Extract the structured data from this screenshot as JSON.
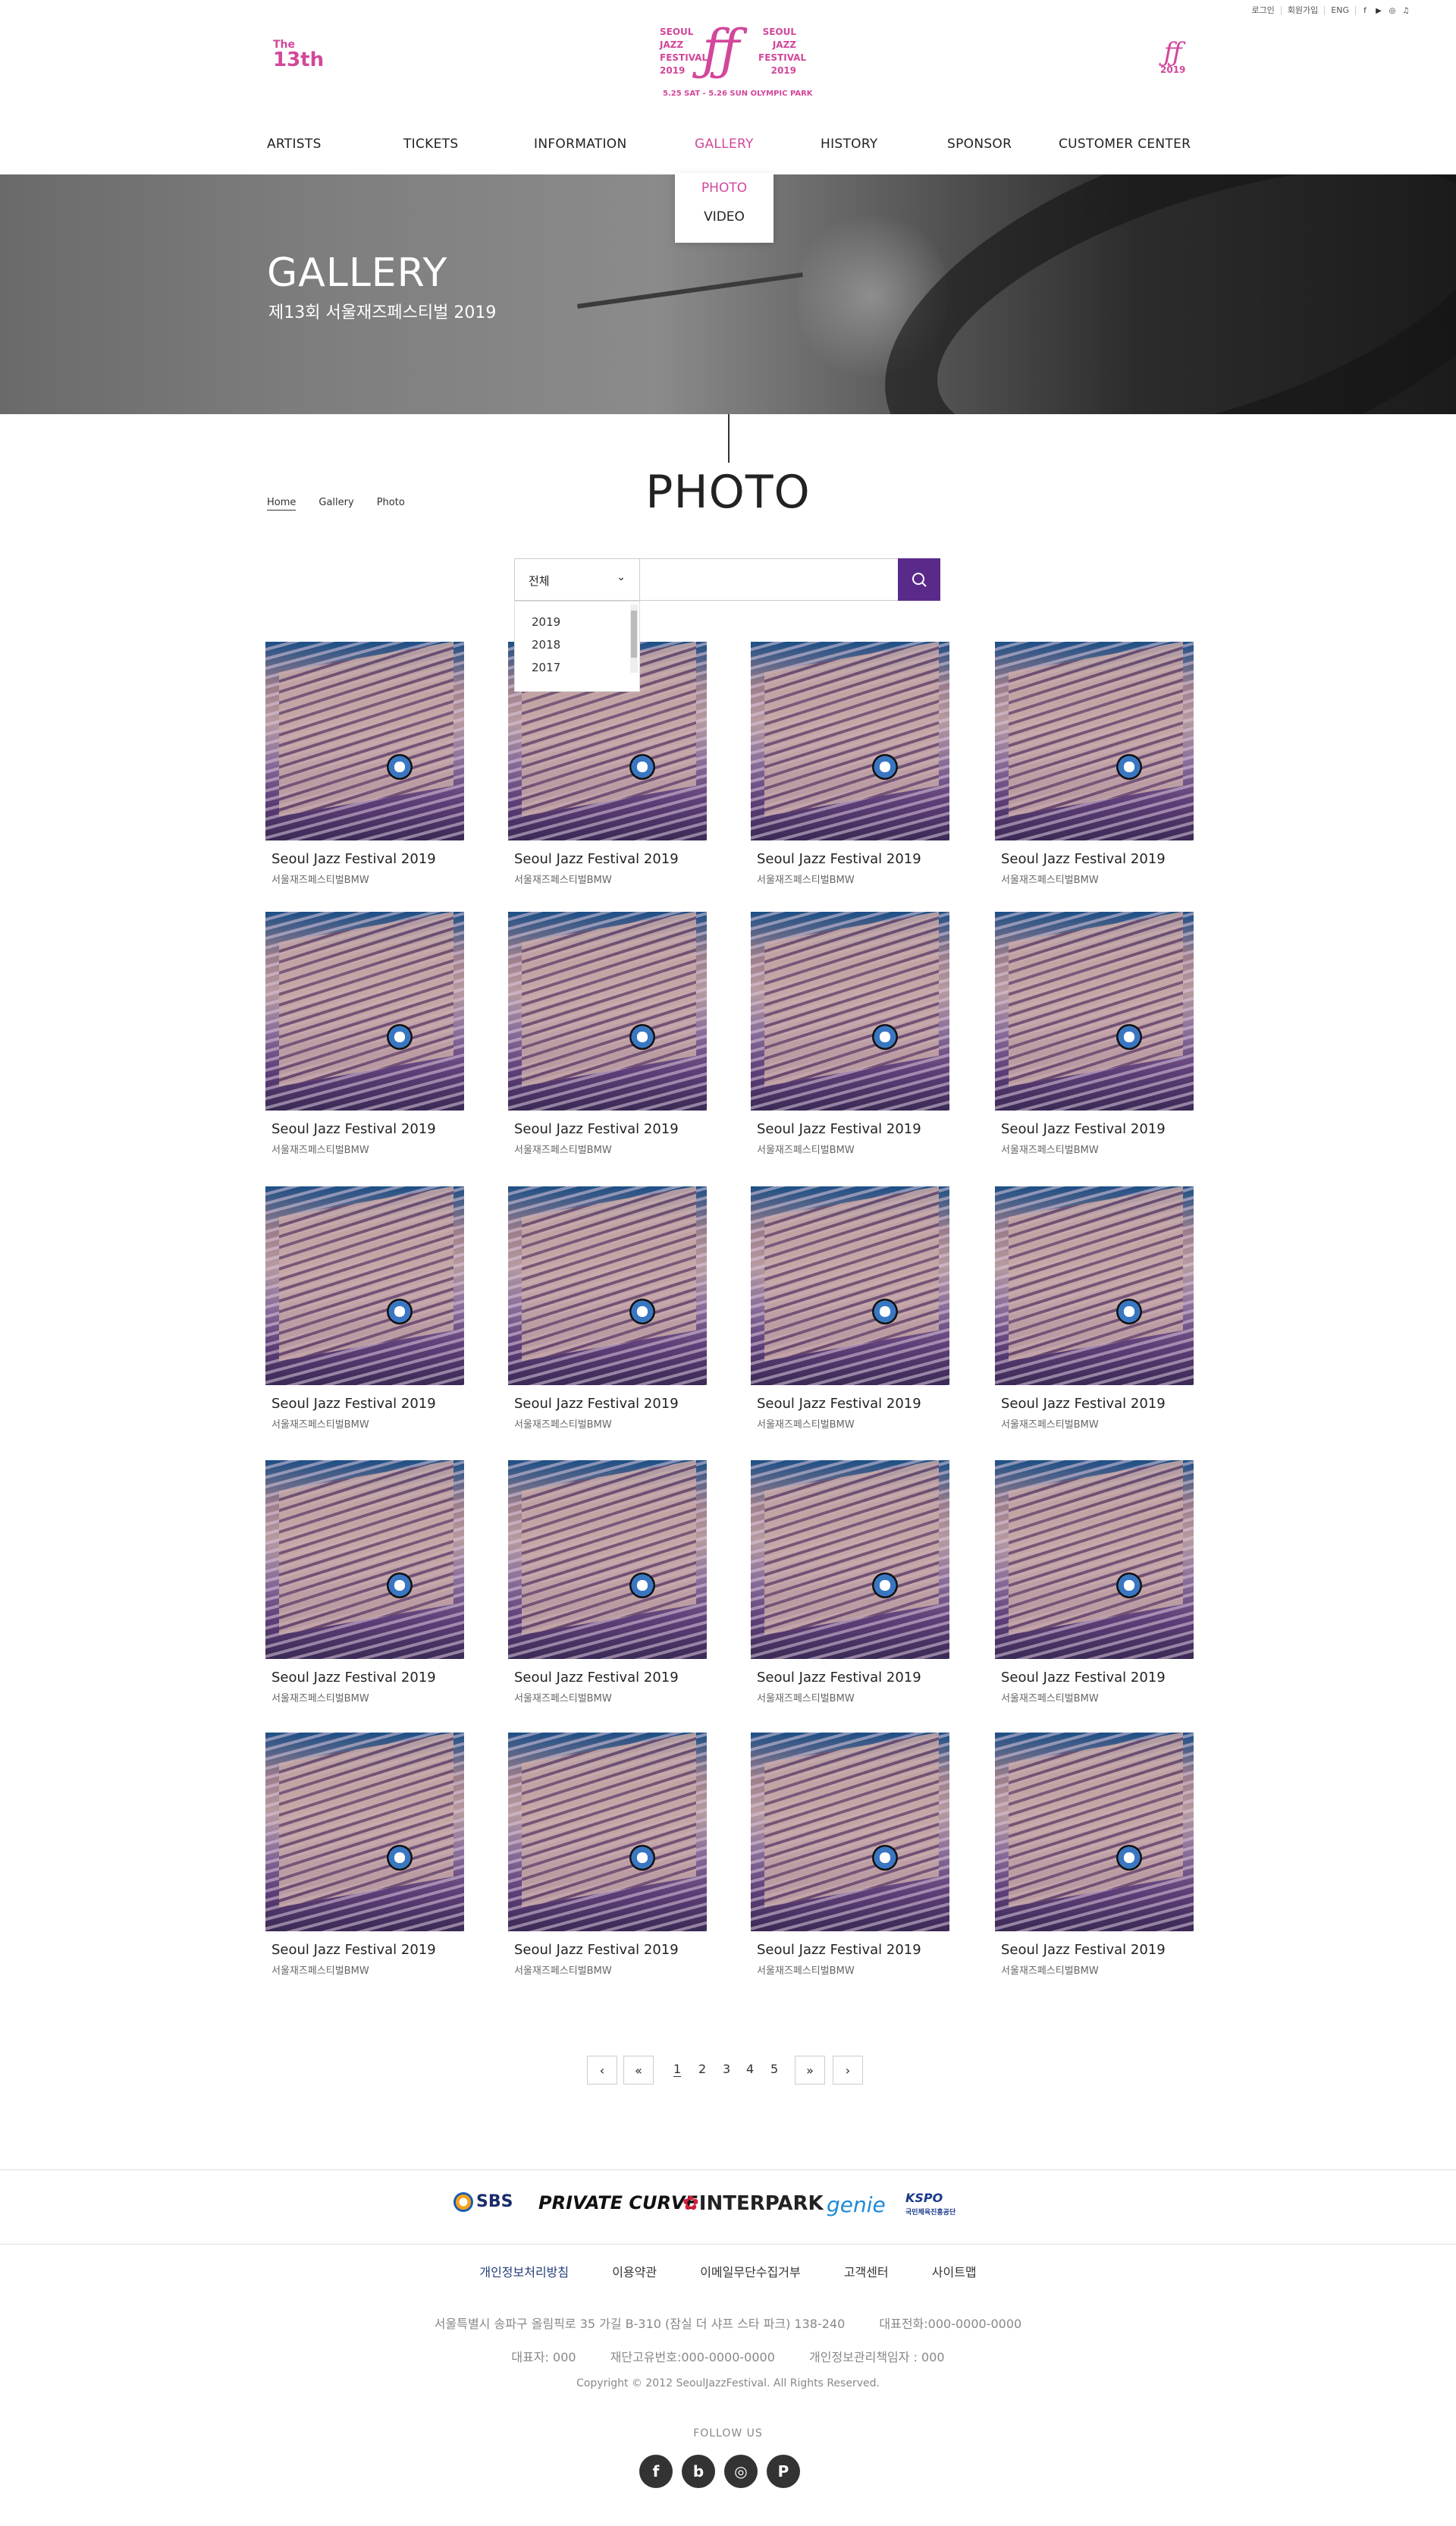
{
  "utility": {
    "login": "로그인",
    "join": "회원가입",
    "lang": "ENG",
    "icons": [
      "facebook-icon",
      "youtube-icon",
      "instagram-icon",
      "music-icon"
    ]
  },
  "header": {
    "badge_the": "The",
    "badge_num": "13th",
    "logo_left": [
      "SEOUL",
      "JAZZ",
      "FESTIVAL",
      "2019"
    ],
    "logo_right": [
      "SEOUL",
      "JAZZ",
      "FESTIVAL",
      "2019"
    ],
    "logo_mark": "ƒƒ",
    "logo_dates": "5.25 SAT - 5.26 SUN OLYMPIC PARK",
    "side_mark": "ƒƒ",
    "side_year": "2019"
  },
  "nav": [
    "ARTISTS",
    "TICKETS",
    "INFORMATION",
    "GALLERY",
    "HISTORY",
    "SPONSOR",
    "CUSTOMER CENTER"
  ],
  "gallery_dropdown": [
    "PHOTO",
    "VIDEO"
  ],
  "hero": {
    "title": "GALLERY",
    "subtitle": "제13회 서울재즈페스티벌 2019"
  },
  "breadcrumb": [
    "Home",
    "Gallery",
    "Photo"
  ],
  "page_title": "PHOTO",
  "search": {
    "selected": "전체",
    "options": [
      "2019",
      "2018",
      "2017"
    ],
    "placeholder": ""
  },
  "cards": [
    {
      "title": "Seoul Jazz Festival 2019",
      "sub": "서울재즈페스티벌BMW"
    },
    {
      "title": "Seoul Jazz Festival 2019",
      "sub": "서울재즈페스티벌BMW"
    },
    {
      "title": "Seoul Jazz Festival 2019",
      "sub": "서울재즈페스티벌BMW"
    },
    {
      "title": "Seoul Jazz Festival 2019",
      "sub": "서울재즈페스티벌BMW"
    },
    {
      "title": "Seoul Jazz Festival 2019",
      "sub": "서울재즈페스티벌BMW"
    },
    {
      "title": "Seoul Jazz Festival 2019",
      "sub": "서울재즈페스티벌BMW"
    },
    {
      "title": "Seoul Jazz Festival 2019",
      "sub": "서울재즈페스티벌BMW"
    },
    {
      "title": "Seoul Jazz Festival 2019",
      "sub": "서울재즈페스티벌BMW"
    },
    {
      "title": "Seoul Jazz Festival 2019",
      "sub": "서울재즈페스티벌BMW"
    },
    {
      "title": "Seoul Jazz Festival 2019",
      "sub": "서울재즈페스티벌BMW"
    },
    {
      "title": "Seoul Jazz Festival 2019",
      "sub": "서울재즈페스티벌BMW"
    },
    {
      "title": "Seoul Jazz Festival 2019",
      "sub": "서울재즈페스티벌BMW"
    },
    {
      "title": "Seoul Jazz Festival 2019",
      "sub": "서울재즈페스티벌BMW"
    },
    {
      "title": "Seoul Jazz Festival 2019",
      "sub": "서울재즈페스티벌BMW"
    },
    {
      "title": "Seoul Jazz Festival 2019",
      "sub": "서울재즈페스티벌BMW"
    },
    {
      "title": "Seoul Jazz Festival 2019",
      "sub": "서울재즈페스티벌BMW"
    },
    {
      "title": "Seoul Jazz Festival 2019",
      "sub": "서울재즈페스티벌BMW"
    },
    {
      "title": "Seoul Jazz Festival 2019",
      "sub": "서울재즈페스티벌BMW"
    },
    {
      "title": "Seoul Jazz Festival 2019",
      "sub": "서울재즈페스티벌BMW"
    },
    {
      "title": "Seoul Jazz Festival 2019",
      "sub": "서울재즈페스티벌BMW"
    }
  ],
  "pagination": {
    "prev": "‹",
    "first": "«",
    "pages": [
      "1",
      "2",
      "3",
      "4",
      "5"
    ],
    "current": "1",
    "last": "»",
    "next": "›"
  },
  "sponsors": [
    "SBS",
    "PRIVATE CURVE",
    "INTERPARK",
    "genie",
    "KSPO",
    "국민체육진흥공단"
  ],
  "footer": {
    "links": [
      "개인정보처리방침",
      "이용약관",
      "이메일무단수집거부",
      "고객센터",
      "사이트맵"
    ],
    "address": "서울특별시 송파구 올림픽로 35 가길 B-310 (잠실 더 샤프 스타 파크) 138-240",
    "phone": "대표전화:000-0000-0000",
    "ceo": "대표자: 000",
    "bizno": "재단고유번호:000-0000-0000",
    "privacy_officer": "개인정보관리책임자 : 000",
    "copyright": "Copyright © 2012 SeoulJazzFestival. All Rights Reserved.",
    "follow": "FOLLOW US",
    "socials": [
      "f",
      "b",
      "◎",
      "P"
    ]
  },
  "colors": {
    "accent": "#d2479b",
    "search_button": "#5a2a8a"
  }
}
